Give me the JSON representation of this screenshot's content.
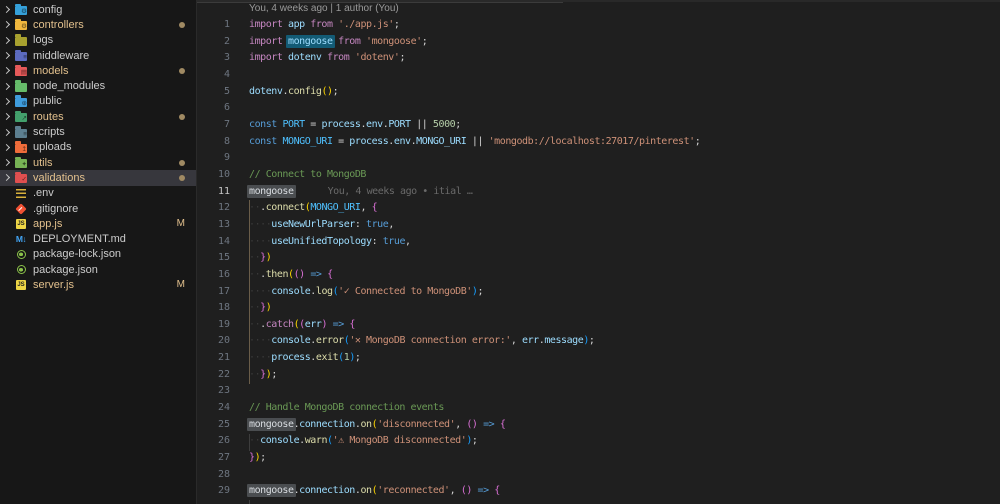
{
  "colors": {
    "editor_bg": "#1f1f1f",
    "sidebar_bg": "#171717",
    "selected_row_bg": "#37373d",
    "modified_label": "#e2c08d",
    "keyword": "#C586C0",
    "keyword_storage": "#569CD6",
    "identifier": "#9CDCFE",
    "constant": "#4FC1FF",
    "string": "#CE9178",
    "function": "#DCDCAA",
    "number": "#B5CEA8",
    "comment": "#6A9955",
    "punctuation": "#D4D4D4",
    "bracket_level1": "#FFD700",
    "bracket_level2": "#DA70D6",
    "bracket_level3": "#179FFF",
    "line_number": "#6e7681",
    "active_line_number": "#c6c6c6",
    "word_highlight": "#4a4d50",
    "word_highlight_strong": "#135b75",
    "git_modified_dot": "#a08a63",
    "indent_guide_active": "#6a5d49"
  },
  "sidebar": {
    "items": [
      {
        "label": "config",
        "type": "folder",
        "color": "#35a0d9",
        "emblem": "⚙",
        "modified": false
      },
      {
        "label": "controllers",
        "type": "folder",
        "color": "#f0b73e",
        "emblem": "⚙",
        "modified": true
      },
      {
        "label": "logs",
        "type": "folder",
        "color": "#a8a12f",
        "emblem": "",
        "modified": false
      },
      {
        "label": "middleware",
        "type": "folder",
        "color": "#5c6bc0",
        "emblem": "≡",
        "modified": false
      },
      {
        "label": "models",
        "type": "folder",
        "color": "#e65a5a",
        "emblem": "▤",
        "modified": true
      },
      {
        "label": "node_modules",
        "type": "folder",
        "color": "#66bb6a",
        "emblem": "",
        "modified": false
      },
      {
        "label": "public",
        "type": "folder",
        "color": "#3f9cdc",
        "emblem": "⊕",
        "modified": false
      },
      {
        "label": "routes",
        "type": "folder",
        "color": "#43a06c",
        "emblem": "↗",
        "modified": true
      },
      {
        "label": "scripts",
        "type": "folder",
        "color": "#5d7f90",
        "emblem": "≡",
        "modified": false
      },
      {
        "label": "uploads",
        "type": "folder",
        "color": "#ef6c3a",
        "emblem": "↥",
        "modified": false
      },
      {
        "label": "utils",
        "type": "folder",
        "color": "#77b255",
        "emblem": "✦",
        "modified": true
      },
      {
        "label": "validations",
        "type": "folder",
        "color": "#e04f4f",
        "emblem": "✓",
        "modified": true,
        "selected": true
      },
      {
        "label": ".env",
        "type": "file",
        "icon": "env",
        "modified": false
      },
      {
        "label": ".gitignore",
        "type": "file",
        "icon": "git",
        "modified": false
      },
      {
        "label": "app.js",
        "type": "file",
        "icon": "js",
        "modified": true,
        "badge": "M"
      },
      {
        "label": "DEPLOYMENT.md",
        "type": "file",
        "icon": "md",
        "modified": false
      },
      {
        "label": "package-lock.json",
        "type": "file",
        "icon": "node",
        "modified": false
      },
      {
        "label": "package.json",
        "type": "file",
        "icon": "node",
        "modified": false
      },
      {
        "label": "server.js",
        "type": "file",
        "icon": "js",
        "modified": true,
        "badge": "M"
      }
    ]
  },
  "editor": {
    "codelens": "You, 4 weeks ago | 1 author (You)",
    "inline_blame": "You, 4 weeks ago • itial …",
    "lines": [
      {
        "n": 1,
        "tokens": [
          [
            "kw",
            "import "
          ],
          [
            "id",
            "app"
          ],
          [
            "kw",
            " from "
          ],
          [
            "str",
            "'./app.js'"
          ],
          [
            "pun",
            ";"
          ]
        ]
      },
      {
        "n": 2,
        "tokens": [
          [
            "kw",
            "import "
          ],
          [
            "id hl-blue",
            "mongoose"
          ],
          [
            "kw",
            " from "
          ],
          [
            "str",
            "'mongoose'"
          ],
          [
            "pun",
            ";"
          ]
        ]
      },
      {
        "n": 3,
        "tokens": [
          [
            "kw",
            "import "
          ],
          [
            "id",
            "dotenv"
          ],
          [
            "kw",
            " from "
          ],
          [
            "str",
            "'dotenv'"
          ],
          [
            "pun",
            ";"
          ]
        ]
      },
      {
        "n": 4,
        "tokens": []
      },
      {
        "n": 5,
        "tokens": [
          [
            "id",
            "dotenv"
          ],
          [
            "pun",
            "."
          ],
          [
            "fn",
            "config"
          ],
          [
            "b1",
            "()"
          ],
          [
            "pun",
            ";"
          ]
        ]
      },
      {
        "n": 6,
        "tokens": []
      },
      {
        "n": 7,
        "tokens": [
          [
            "kw2",
            "const "
          ],
          [
            "const",
            "PORT"
          ],
          [
            "pun",
            " = "
          ],
          [
            "id",
            "process"
          ],
          [
            "pun",
            "."
          ],
          [
            "id",
            "env"
          ],
          [
            "pun",
            "."
          ],
          [
            "id",
            "PORT"
          ],
          [
            "pun",
            " || "
          ],
          [
            "num",
            "5000"
          ],
          [
            "pun",
            ";"
          ]
        ]
      },
      {
        "n": 8,
        "tokens": [
          [
            "kw2",
            "const "
          ],
          [
            "const",
            "MONGO_URI"
          ],
          [
            "pun",
            " = "
          ],
          [
            "id",
            "process"
          ],
          [
            "pun",
            "."
          ],
          [
            "id",
            "env"
          ],
          [
            "pun",
            "."
          ],
          [
            "id",
            "MONGO_URI"
          ],
          [
            "pun",
            " || "
          ],
          [
            "str",
            "'mongodb://localhost:27017/pinterest'"
          ],
          [
            "pun",
            ";"
          ]
        ]
      },
      {
        "n": 9,
        "tokens": []
      },
      {
        "n": 10,
        "tokens": [
          [
            "cm",
            "// Connect to MongoDB"
          ]
        ]
      },
      {
        "n": 11,
        "active": true,
        "tokens": [
          [
            "id hl-gray",
            "mongoose"
          ],
          [
            "ghost",
            "You, 4 weeks ago • itial …"
          ]
        ]
      },
      {
        "n": 12,
        "tokens": [
          [
            "ws",
            "··"
          ],
          [
            "pun",
            "."
          ],
          [
            "fn",
            "connect"
          ],
          [
            "b1",
            "("
          ],
          [
            "const",
            "MONGO_URI"
          ],
          [
            "pun",
            ", "
          ],
          [
            "b2",
            "{"
          ]
        ]
      },
      {
        "n": 13,
        "tokens": [
          [
            "ws",
            "····"
          ],
          [
            "id",
            "useNewUrlParser"
          ],
          [
            "pun",
            ": "
          ],
          [
            "kw2",
            "true"
          ],
          [
            "pun",
            ","
          ]
        ]
      },
      {
        "n": 14,
        "tokens": [
          [
            "ws",
            "····"
          ],
          [
            "id",
            "useUnifiedTopology"
          ],
          [
            "pun",
            ": "
          ],
          [
            "kw2",
            "true"
          ],
          [
            "pun",
            ","
          ]
        ]
      },
      {
        "n": 15,
        "tokens": [
          [
            "ws",
            "··"
          ],
          [
            "b2",
            "}"
          ],
          [
            "b1",
            ")"
          ]
        ]
      },
      {
        "n": 16,
        "tokens": [
          [
            "ws",
            "··"
          ],
          [
            "pun",
            "."
          ],
          [
            "fn",
            "then"
          ],
          [
            "b1",
            "("
          ],
          [
            "b2",
            "()"
          ],
          [
            "pun",
            " "
          ],
          [
            "kw2",
            "=>"
          ],
          [
            "pun",
            " "
          ],
          [
            "b2",
            "{"
          ]
        ]
      },
      {
        "n": 17,
        "tokens": [
          [
            "ws",
            "····"
          ],
          [
            "id",
            "console"
          ],
          [
            "pun",
            "."
          ],
          [
            "fn",
            "log"
          ],
          [
            "b3",
            "("
          ],
          [
            "str",
            "'✓ Connected to MongoDB'"
          ],
          [
            "b3",
            ")"
          ],
          [
            "pun",
            ";"
          ]
        ]
      },
      {
        "n": 18,
        "tokens": [
          [
            "ws",
            "··"
          ],
          [
            "b2",
            "}"
          ],
          [
            "b1",
            ")"
          ]
        ]
      },
      {
        "n": 19,
        "tokens": [
          [
            "ws",
            "··"
          ],
          [
            "pun",
            "."
          ],
          [
            "kw",
            "catch"
          ],
          [
            "b1",
            "("
          ],
          [
            "b2",
            "("
          ],
          [
            "id",
            "err"
          ],
          [
            "b2",
            ")"
          ],
          [
            "pun",
            " "
          ],
          [
            "kw2",
            "=>"
          ],
          [
            "pun",
            " "
          ],
          [
            "b2",
            "{"
          ]
        ]
      },
      {
        "n": 20,
        "tokens": [
          [
            "ws",
            "····"
          ],
          [
            "id",
            "console"
          ],
          [
            "pun",
            "."
          ],
          [
            "fn",
            "error"
          ],
          [
            "b3",
            "("
          ],
          [
            "str",
            "'✕ MongoDB connection error:'"
          ],
          [
            "pun",
            ", "
          ],
          [
            "id",
            "err"
          ],
          [
            "pun",
            "."
          ],
          [
            "id",
            "message"
          ],
          [
            "b3",
            ")"
          ],
          [
            "pun",
            ";"
          ]
        ]
      },
      {
        "n": 21,
        "tokens": [
          [
            "ws",
            "····"
          ],
          [
            "id",
            "process"
          ],
          [
            "pun",
            "."
          ],
          [
            "fn",
            "exit"
          ],
          [
            "b3",
            "("
          ],
          [
            "num",
            "1"
          ],
          [
            "b3",
            ")"
          ],
          [
            "pun",
            ";"
          ]
        ]
      },
      {
        "n": 22,
        "tokens": [
          [
            "ws",
            "··"
          ],
          [
            "b2",
            "}"
          ],
          [
            "b1",
            ")"
          ],
          [
            "pun",
            ";"
          ]
        ]
      },
      {
        "n": 23,
        "tokens": []
      },
      {
        "n": 24,
        "tokens": [
          [
            "cm",
            "// Handle MongoDB connection events"
          ]
        ]
      },
      {
        "n": 25,
        "tokens": [
          [
            "id hl-gray",
            "mongoose"
          ],
          [
            "pun",
            "."
          ],
          [
            "id",
            "connection"
          ],
          [
            "pun",
            "."
          ],
          [
            "fn",
            "on"
          ],
          [
            "b1",
            "("
          ],
          [
            "str",
            "'disconnected'"
          ],
          [
            "pun",
            ", "
          ],
          [
            "b2",
            "()"
          ],
          [
            "pun",
            " "
          ],
          [
            "kw2",
            "=>"
          ],
          [
            "pun",
            " "
          ],
          [
            "b2",
            "{"
          ]
        ]
      },
      {
        "n": 26,
        "tokens": [
          [
            "ws",
            "··"
          ],
          [
            "id",
            "console"
          ],
          [
            "pun",
            "."
          ],
          [
            "fn",
            "warn"
          ],
          [
            "b3",
            "("
          ],
          [
            "str",
            "'⚠ MongoDB disconnected'"
          ],
          [
            "b3",
            ")"
          ],
          [
            "pun",
            ";"
          ]
        ]
      },
      {
        "n": 27,
        "tokens": [
          [
            "b2",
            "}"
          ],
          [
            "b1",
            ")"
          ],
          [
            "pun",
            ";"
          ]
        ]
      },
      {
        "n": 28,
        "tokens": []
      },
      {
        "n": 29,
        "tokens": [
          [
            "id hl-gray",
            "mongoose"
          ],
          [
            "pun",
            "."
          ],
          [
            "id",
            "connection"
          ],
          [
            "pun",
            "."
          ],
          [
            "fn",
            "on"
          ],
          [
            "b1",
            "("
          ],
          [
            "str",
            "'reconnected'"
          ],
          [
            "pun",
            ", "
          ],
          [
            "b2",
            "()"
          ],
          [
            "pun",
            " "
          ],
          [
            "kw2",
            "=>"
          ],
          [
            "pun",
            " "
          ],
          [
            "b2",
            "{"
          ]
        ]
      }
    ]
  }
}
